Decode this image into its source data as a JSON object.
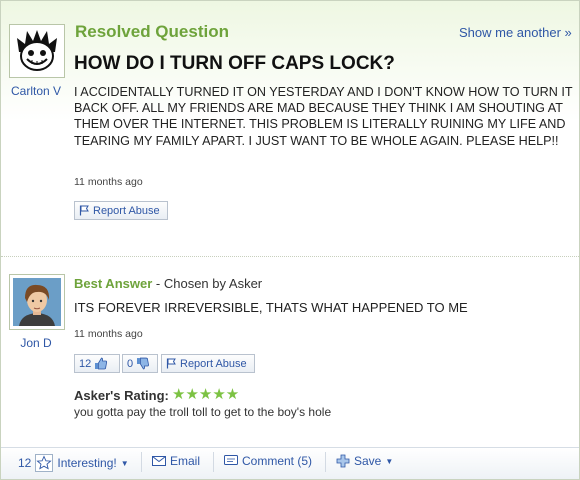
{
  "question": {
    "status": "Resolved Question",
    "show_more": "Show me another »",
    "asker": "Carlton V",
    "title": "HOW DO I TURN OFF CAPS LOCK?",
    "body": "I ACCIDENTALLY TURNED IT ON YESTERDAY AND I DON'T KNOW HOW TO TURN IT BACK OFF. ALL MY FRIENDS ARE MAD BECAUSE THEY THINK I AM SHOUTING AT THEM OVER THE INTERNET. THIS PROBLEM IS LITERALLY RUINING MY LIFE AND TEARING MY FAMILY APART. I JUST WANT TO BE WHOLE AGAIN. PLEASE HELP!!",
    "time": "11 months ago",
    "report_label": "Report Abuse"
  },
  "answer": {
    "label": "Best Answer",
    "chosen_by": "- Chosen by Asker",
    "answerer": "Jon D",
    "text": "ITS FOREVER IRREVERSIBLE, THATS WHAT HAPPENED TO ME",
    "time": "11 months ago",
    "thumbs_up": "12",
    "thumbs_down": "0",
    "report_label": "Report Abuse",
    "rating_label": "Asker's Rating:",
    "rating_stars": "★★★★★",
    "rating_value": 5,
    "rating_comment": "you gotta pay the troll toll to get to the boy's hole"
  },
  "bottom_bar": {
    "interesting_count": "12",
    "interesting_label": "Interesting!",
    "email_label": "Email",
    "comment_label": "Comment (5)",
    "save_label": "Save"
  },
  "colors": {
    "accent_green": "#6ea33b",
    "link_blue": "#2f57a6",
    "star_green": "#7cc243"
  }
}
